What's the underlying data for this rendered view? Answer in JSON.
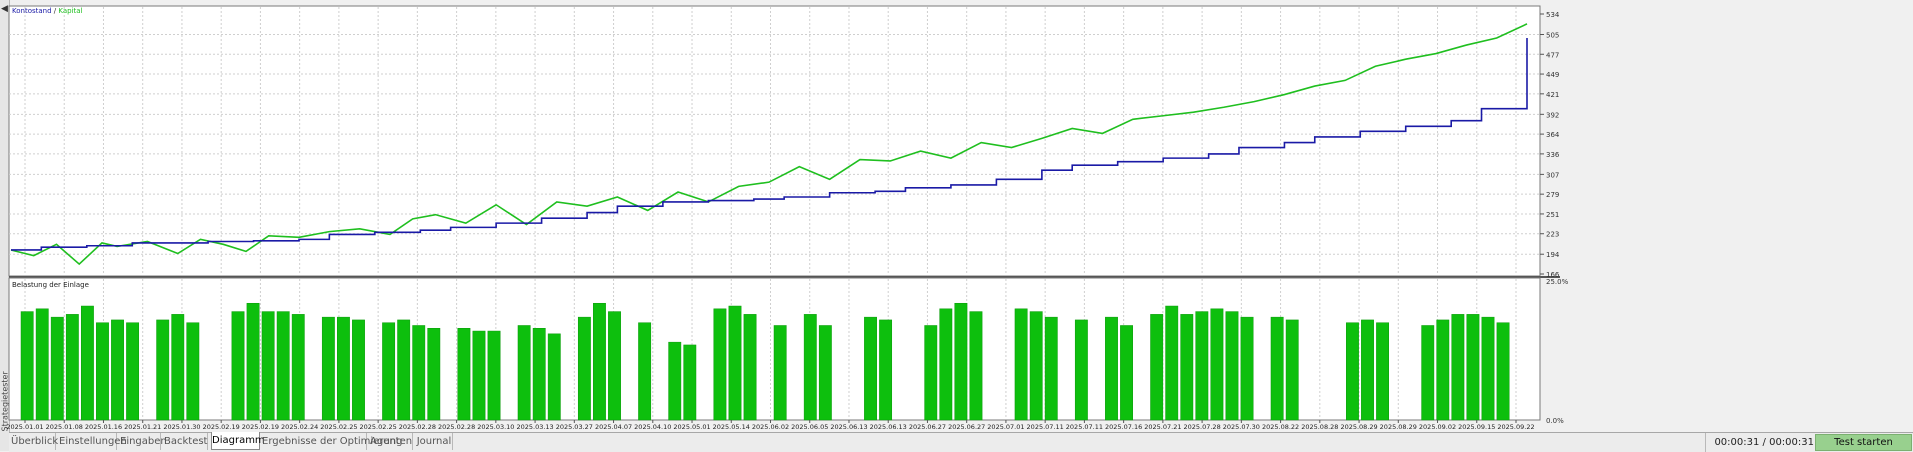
{
  "side_panel": {
    "label": "Strategietester",
    "collapse_arrow": "arrow-left"
  },
  "main_chart": {
    "legend": {
      "balance_label": "Kontostand",
      "separator": "/",
      "equity_label": "Kapital"
    },
    "y_ticks": [
      "534",
      "505",
      "477",
      "449",
      "421",
      "392",
      "364",
      "336",
      "307",
      "279",
      "251",
      "223",
      "194",
      "166"
    ]
  },
  "load_chart": {
    "title": "Belastung der Einlage",
    "y_max_label": "25.0%",
    "y_min_label": "0.0%"
  },
  "x_axis_labels": [
    "2025.01.01",
    "2025.01.08",
    "2025.01.16",
    "2025.01.21",
    "2025.01.30",
    "2025.02.19",
    "2025.02.19",
    "2025.02.24",
    "2025.02.25",
    "2025.02.25",
    "2025.02.28",
    "2025.02.28",
    "2025.03.10",
    "2025.03.13",
    "2025.03.27",
    "2025.04.07",
    "2025.04.10",
    "2025.05.01",
    "2025.05.14",
    "2025.06.02",
    "2025.06.05",
    "2025.06.13",
    "2025.06.13",
    "2025.06.27",
    "2025.06.27",
    "2025.07.01",
    "2025.07.11",
    "2025.07.11",
    "2025.07.16",
    "2025.07.21",
    "2025.07.28",
    "2025.07.30",
    "2025.08.22",
    "2025.08.28",
    "2025.08.29",
    "2025.08.29",
    "2025.09.02",
    "2025.09.15",
    "2025.09.22"
  ],
  "colors": {
    "balance": "#1a1aa6",
    "equity": "#1fbf1f",
    "load_bars": "#0dbf0d",
    "grid": "#cfcfcf",
    "start_button": "#98d08e"
  },
  "chart_data": [
    {
      "type": "line",
      "title": "",
      "legend_position": "top-left",
      "grid": true,
      "ylim": [
        166,
        534
      ],
      "x_index_range": [
        0,
        100
      ],
      "series": [
        {
          "name": "Kontostand",
          "x": [
            0,
            2,
            5,
            8,
            10,
            13,
            16,
            19,
            21,
            24,
            27,
            29,
            32,
            35,
            38,
            40,
            43,
            46,
            49,
            51,
            54,
            57,
            59,
            62,
            65,
            68,
            70,
            73,
            76,
            79,
            81,
            84,
            86,
            89,
            92,
            95,
            97,
            100
          ],
          "y": [
            200,
            204,
            206,
            210,
            210,
            212,
            213,
            215,
            222,
            225,
            228,
            232,
            238,
            245,
            253,
            262,
            268,
            270,
            272,
            275,
            281,
            283,
            288,
            292,
            300,
            313,
            320,
            325,
            330,
            336,
            345,
            352,
            360,
            368,
            375,
            383,
            400,
            500
          ]
        },
        {
          "name": "Kapital",
          "x": [
            0,
            1.5,
            3,
            4.5,
            6,
            7,
            9,
            11,
            12.5,
            14,
            15.5,
            17,
            19,
            21,
            23,
            25,
            26.5,
            28,
            30,
            32,
            34,
            36,
            38,
            40,
            42,
            44,
            46,
            48,
            50,
            52,
            54,
            56,
            58,
            60,
            62,
            64,
            66,
            68,
            70,
            72,
            74,
            76,
            78,
            80,
            82,
            84,
            86,
            88,
            90,
            92,
            94,
            96,
            98,
            100
          ],
          "y": [
            200,
            192,
            208,
            180,
            210,
            205,
            212,
            195,
            215,
            208,
            198,
            220,
            218,
            226,
            230,
            222,
            244,
            250,
            238,
            264,
            236,
            268,
            262,
            275,
            256,
            282,
            268,
            290,
            296,
            318,
            300,
            328,
            326,
            340,
            330,
            352,
            345,
            358,
            372,
            365,
            385,
            390,
            395,
            402,
            410,
            420,
            432,
            440,
            460,
            470,
            478,
            490,
            500,
            520
          ]
        }
      ]
    },
    {
      "type": "bar",
      "title": "Belastung der Einlage",
      "ylim": [
        0,
        25
      ],
      "y_unit": "%",
      "values": [
        19.5,
        20,
        18.5,
        19,
        20.5,
        17.5,
        18,
        17.5,
        0,
        18,
        19,
        17.5,
        0,
        0,
        19.5,
        21,
        19.5,
        19.5,
        19,
        0,
        18.5,
        18.5,
        18,
        0,
        17.5,
        18,
        17,
        16.5,
        0,
        16.5,
        16,
        16,
        0,
        17,
        16.5,
        15.5,
        0,
        18.5,
        21,
        19.5,
        0,
        17.5,
        0,
        14,
        13.5,
        0,
        20,
        20.5,
        19,
        0,
        17,
        0,
        19,
        17,
        0,
        0,
        18.5,
        18,
        0,
        0,
        17,
        20,
        21,
        19.5,
        0,
        0,
        20,
        19.5,
        18.5,
        0,
        18,
        0,
        18.5,
        17,
        0,
        19,
        20.5,
        19,
        19.5,
        20,
        19.5,
        18.5,
        0,
        18.5,
        18,
        0,
        0,
        0,
        17.5,
        18,
        17.5,
        0,
        0,
        17,
        18,
        19,
        19,
        18.5,
        17.5,
        0
      ]
    }
  ],
  "footer": {
    "tabs": [
      "Überblick",
      "Einstellungen",
      "Eingaben",
      "Backtest",
      "Diagramm",
      "Ergebnisse der Optimierung",
      "Agenten",
      "Journal"
    ],
    "active_tab": "Diagramm",
    "timer": "00:00:31 / 00:00:31",
    "start_button": "Test starten"
  }
}
